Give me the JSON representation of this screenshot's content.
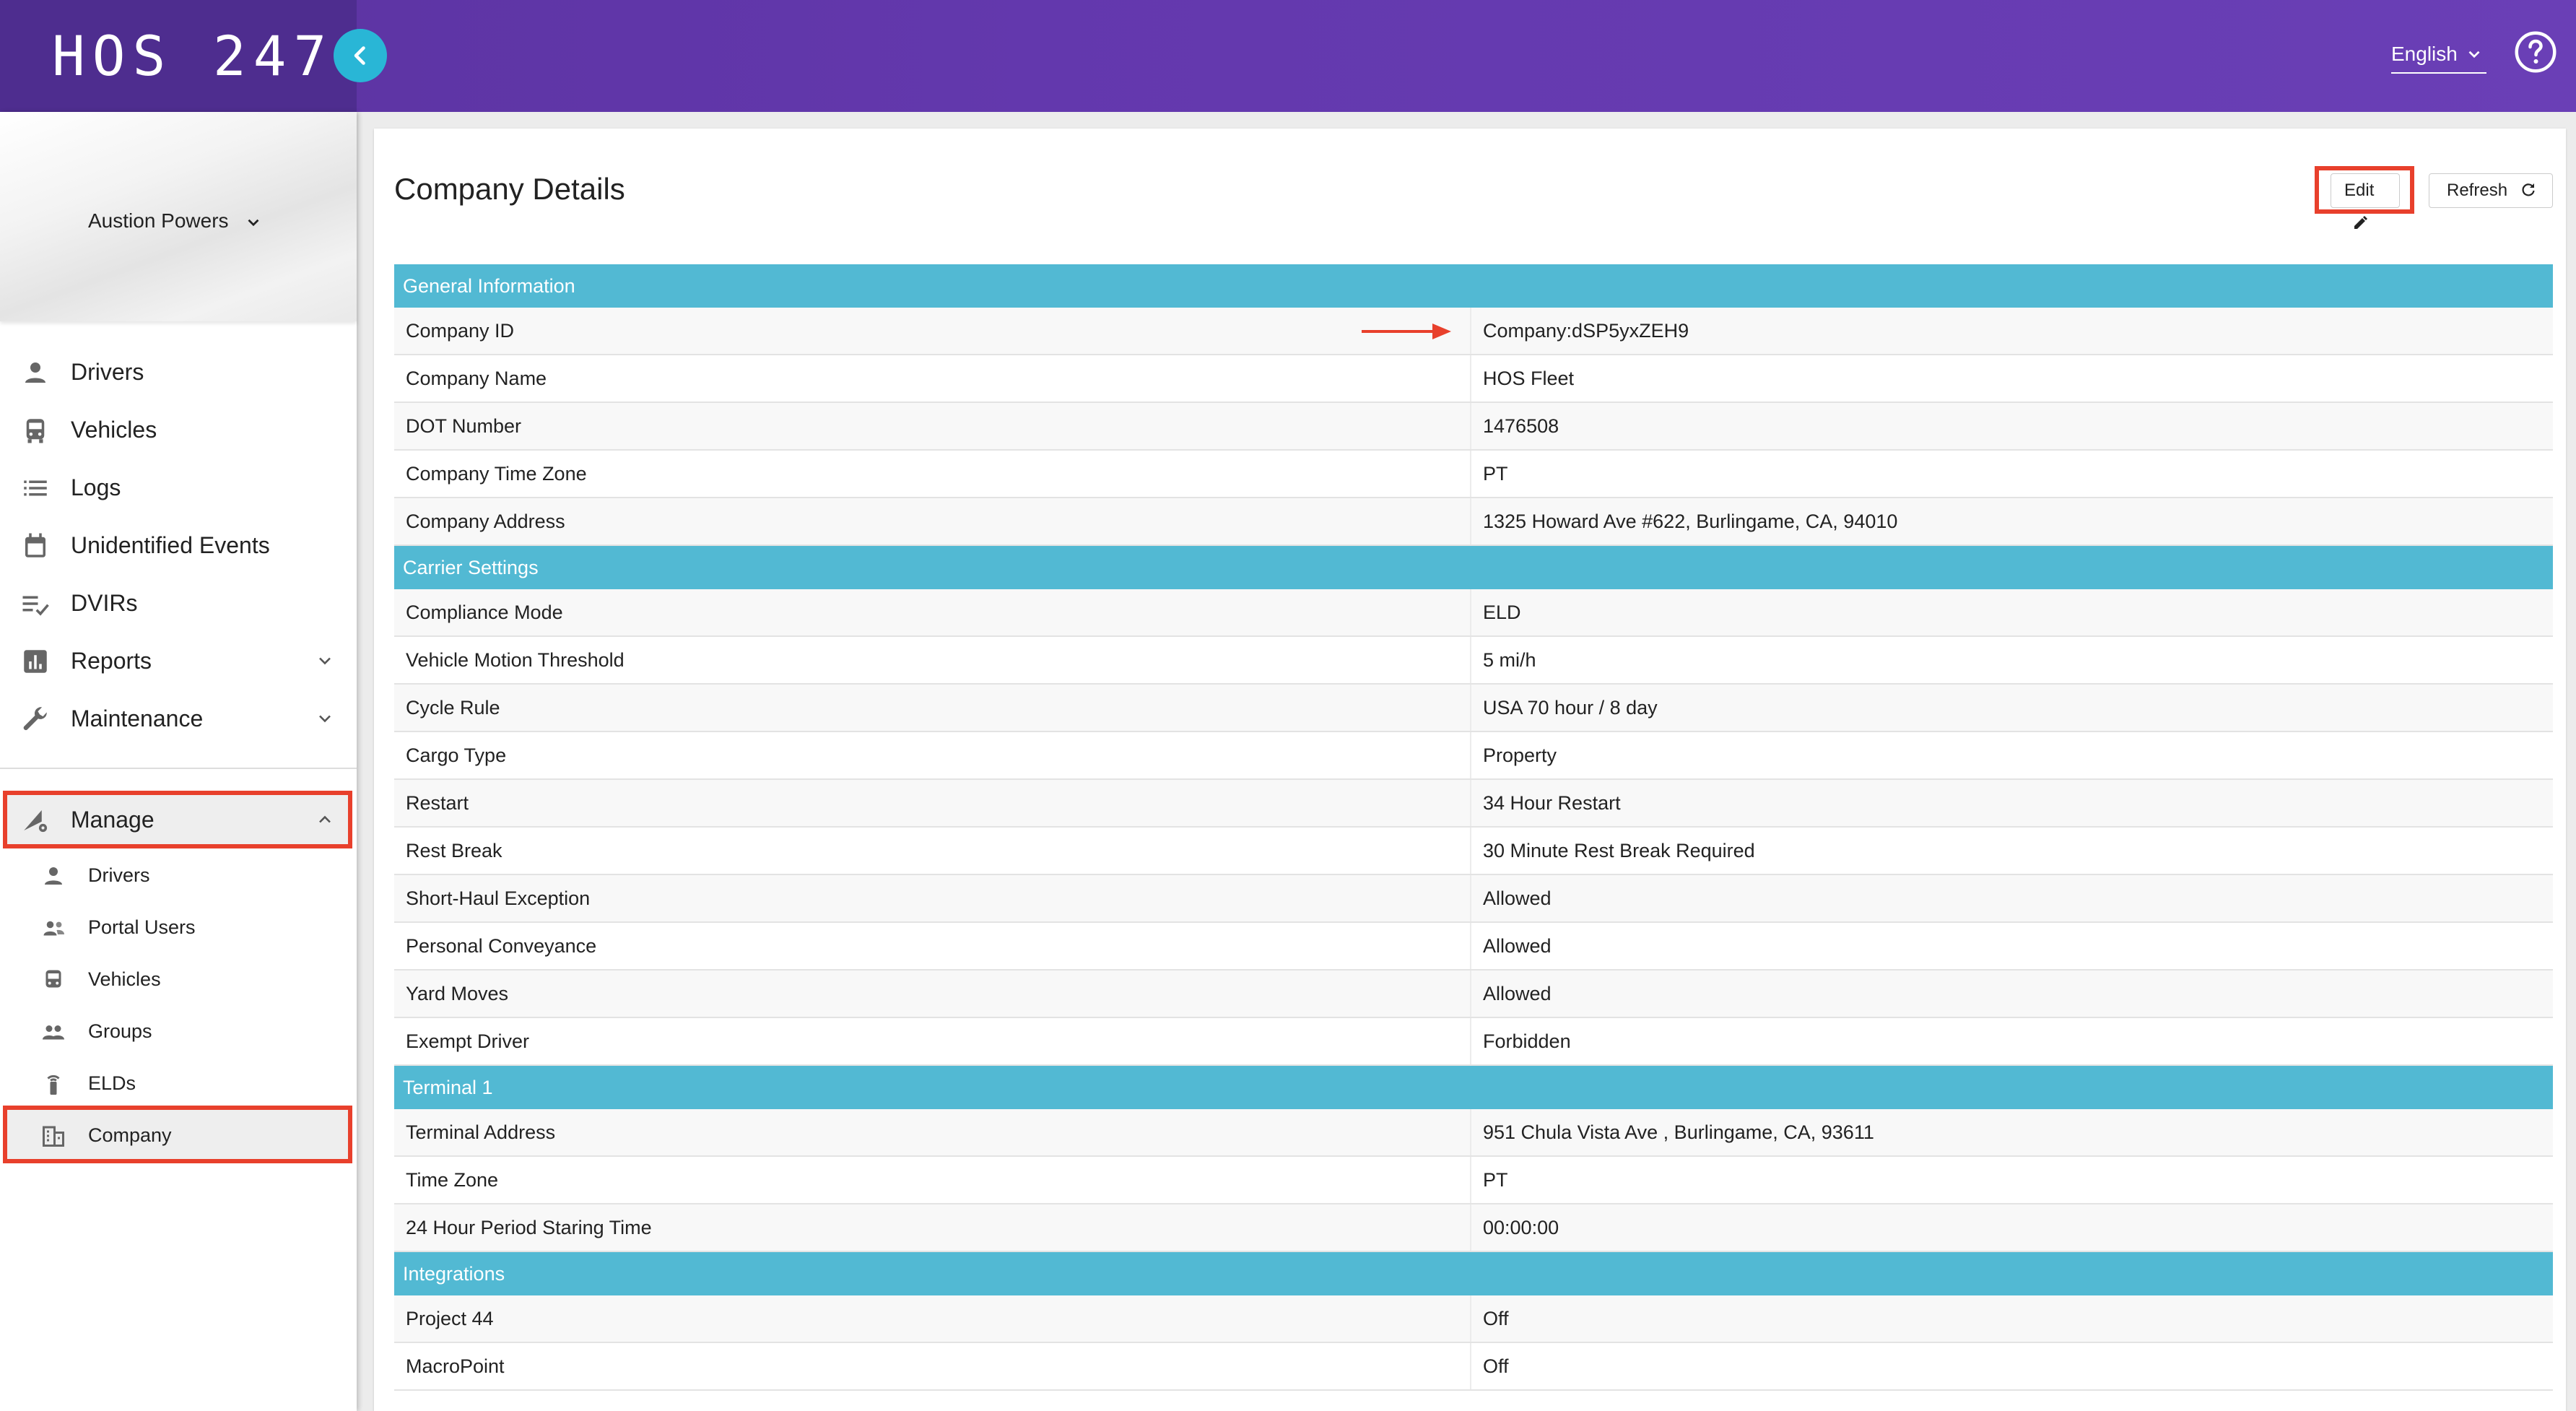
{
  "app": {
    "logo_text": "HOS 247",
    "language": "English"
  },
  "sidebar": {
    "user_name": "Austion Powers",
    "nav": [
      {
        "label": "Drivers",
        "icon": "person-icon"
      },
      {
        "label": "Vehicles",
        "icon": "bus-icon"
      },
      {
        "label": "Logs",
        "icon": "list-icon"
      },
      {
        "label": "Unidentified Events",
        "icon": "calendar-icon"
      },
      {
        "label": "DVIRs",
        "icon": "checklist-icon"
      },
      {
        "label": "Reports",
        "icon": "bar-chart-icon"
      },
      {
        "label": "Maintenance",
        "icon": "wrench-icon"
      }
    ],
    "manage": {
      "label": "Manage",
      "items": [
        {
          "label": "Drivers",
          "icon": "person-icon"
        },
        {
          "label": "Portal Users",
          "icon": "people-icon"
        },
        {
          "label": "Vehicles",
          "icon": "bus-icon"
        },
        {
          "label": "Groups",
          "icon": "group-icon"
        },
        {
          "label": "ELDs",
          "icon": "antenna-icon"
        },
        {
          "label": "Company",
          "icon": "building-icon"
        }
      ]
    }
  },
  "main": {
    "title": "Company Details",
    "edit_label": "Edit",
    "refresh_label": "Refresh",
    "sections": [
      {
        "title": "General Information",
        "rows": [
          {
            "key": "Company ID",
            "value": "Company:dSP5yxZEH9"
          },
          {
            "key": "Company Name",
            "value": "HOS Fleet"
          },
          {
            "key": "DOT Number",
            "value": "1476508"
          },
          {
            "key": "Company Time Zone",
            "value": "PT"
          },
          {
            "key": "Company Address",
            "value": "1325 Howard Ave #622, Burlingame, CA, 94010"
          }
        ]
      },
      {
        "title": "Carrier Settings",
        "rows": [
          {
            "key": "Compliance Mode",
            "value": "ELD"
          },
          {
            "key": "Vehicle Motion Threshold",
            "value": "5 mi/h"
          },
          {
            "key": "Cycle Rule",
            "value": "USA 70 hour / 8 day"
          },
          {
            "key": "Cargo Type",
            "value": "Property"
          },
          {
            "key": "Restart",
            "value": "34 Hour Restart"
          },
          {
            "key": "Rest Break",
            "value": "30 Minute Rest Break Required"
          },
          {
            "key": "Short-Haul Exception",
            "value": "Allowed"
          },
          {
            "key": "Personal Conveyance",
            "value": "Allowed"
          },
          {
            "key": "Yard Moves",
            "value": "Allowed"
          },
          {
            "key": "Exempt Driver",
            "value": "Forbidden"
          }
        ]
      },
      {
        "title": "Terminal 1",
        "rows": [
          {
            "key": "Terminal Address",
            "value": "951 Chula Vista Ave , Burlingame, CA, 93611"
          },
          {
            "key": "Time Zone",
            "value": "PT"
          },
          {
            "key": "24 Hour Period Staring Time",
            "value": "00:00:00"
          }
        ]
      },
      {
        "title": "Integrations",
        "rows": [
          {
            "key": "Project 44",
            "value": "Off"
          },
          {
            "key": "MacroPoint",
            "value": "Off"
          }
        ]
      }
    ]
  },
  "colors": {
    "header": "#6338ad",
    "accent": "#29b6d6",
    "section": "#52b9d3",
    "highlight": "#e8402c"
  }
}
